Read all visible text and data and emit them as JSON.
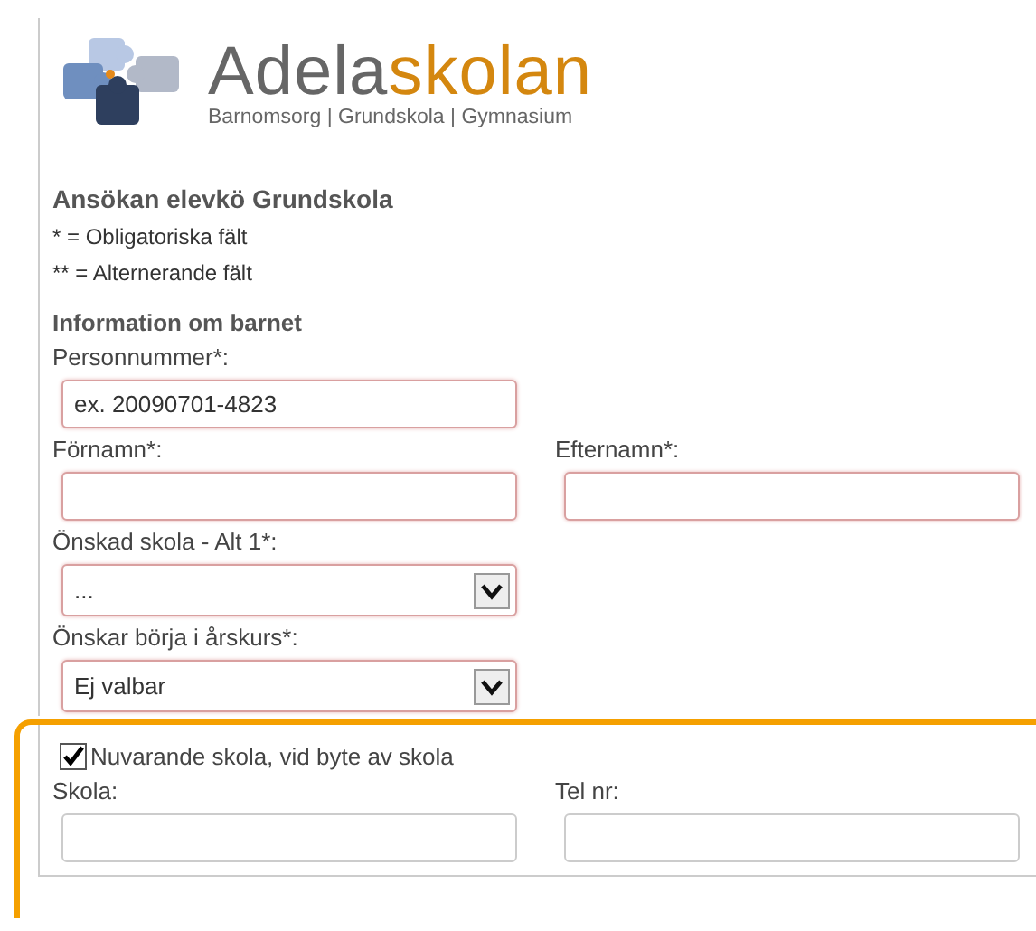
{
  "logo": {
    "name_first": "Adela",
    "name_second": "skolan",
    "tagline": "Barnomsorg | Grundskola | Gymnasium"
  },
  "form": {
    "title": "Ansökan elevkö Grundskola",
    "notes": [
      "* = Obligatoriska fält",
      "** = Alternerande fält"
    ],
    "section": "Information om barnet",
    "rows": [
      [
        {
          "kind": "text",
          "label": "Personnummer*:",
          "placeholder": "ex. 20090701-4823",
          "required": true
        }
      ],
      [
        {
          "kind": "text",
          "label": "Förnamn*:",
          "required": true
        },
        {
          "kind": "text",
          "label": "Efternamn*:",
          "required": true
        }
      ],
      [
        {
          "kind": "select",
          "label": "Önskad skola - Alt 1*:",
          "value": "...",
          "required": true
        }
      ],
      [
        {
          "kind": "select",
          "label": "Önskar börja i årskurs*:",
          "value": "Ej valbar",
          "required": true
        }
      ]
    ]
  },
  "current_school": {
    "highlighted": true,
    "checkbox": {
      "label": "Nuvarande skola, vid byte av skola",
      "checked": true
    },
    "fields": [
      {
        "kind": "text",
        "label": "Skola:",
        "required": false
      },
      {
        "kind": "text",
        "label": "Tel nr:",
        "required": false
      }
    ]
  }
}
